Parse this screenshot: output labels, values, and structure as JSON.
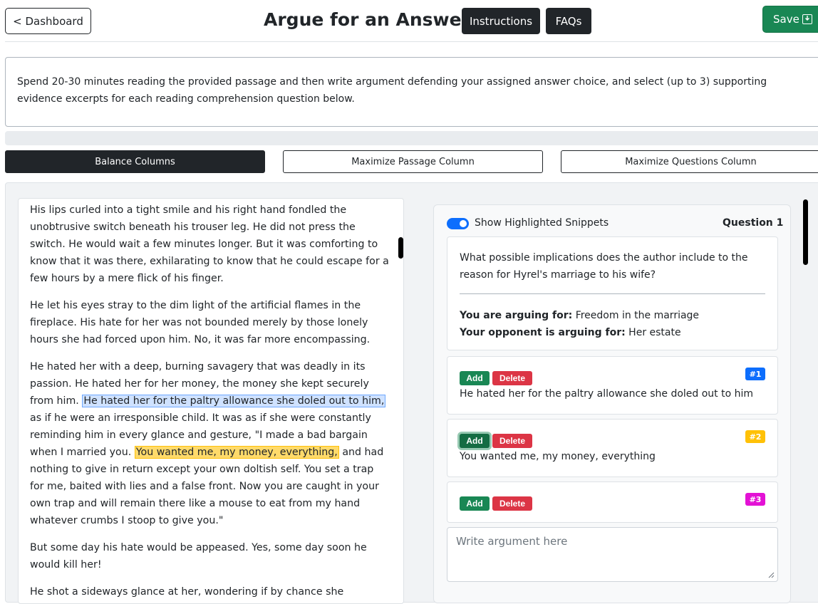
{
  "header": {
    "dashboard_label": "< Dashboard",
    "title": "Argue for an Answer",
    "instructions_label": "Instructions",
    "faqs_label": "FAQs",
    "save_label": "Save"
  },
  "instructions_text": "Spend 20-30 minutes reading the provided passage and then write argument defending your assigned answer choice, and select (up to 3) supporting evidence excerpts for each reading comprehension question below.",
  "layout_buttons": {
    "balance": "Balance Columns",
    "max_passage": "Maximize Passage Column",
    "max_questions": "Maximize Questions Column"
  },
  "passage": {
    "p1": "His lips curled into a tight smile and his right hand fondled the unobtrusive switch beneath his trouser leg. He did not press the switch. He would wait a few minutes longer. But it was comforting to know that it was there, exhilarating to know that he could escape for a few hours by a mere flick of his finger.",
    "p2": "He let his eyes stray to the dim light of the artificial flames in the fireplace. His hate for her was not bounded merely by those lonely hours she had forced upon him. No, it was far more encompassing.",
    "p3_a": "He hated her with a deep, burning savagery that was deadly in its passion. He hated her for her money, the money she kept securely from him. ",
    "p3_hl1": "He hated her for the paltry allowance she doled out to him,",
    "p3_b": " as if he were an irresponsible child. It was as if she were constantly reminding him in every glance and gesture, \"I made a bad bargain when I married you. ",
    "p3_hl2": "You wanted me, my money, everything,",
    "p3_c": " and had nothing to give in return except your own doltish self. You set a trap for me, baited with lies and a false front. Now you are caught in your own trap and will remain there like a mouse to eat from my hand whatever crumbs I stoop to give you.\"",
    "p4": "But some day his hate would be appeased. Yes, some day soon he would kill her!",
    "p5": "He shot a sideways glance at her, wondering if by chance she"
  },
  "question": {
    "toggle_label": "Show Highlighted Snippets",
    "number_label": "Question 1",
    "text": "What possible implications does the author include to the reason for Hyrel's marriage to his wife?",
    "arguing_for_label": "You are arguing for:",
    "arguing_for_value": "Freedom in the marriage",
    "opponent_label": "Your opponent is arguing for:",
    "opponent_value": "Her estate"
  },
  "snippets": [
    {
      "add": "Add",
      "delete": "Delete",
      "badge": "#1",
      "text": "He hated her for the paltry allowance she doled out to him"
    },
    {
      "add": "Add",
      "delete": "Delete",
      "badge": "#2",
      "text": "You wanted me, my money, everything"
    },
    {
      "add": "Add",
      "delete": "Delete",
      "badge": "#3",
      "text": ""
    }
  ],
  "argument_placeholder": "Write argument here",
  "colors": {
    "save_green": "#198754",
    "dark": "#212529",
    "highlight_blue": "#cfe2ff",
    "highlight_yellow": "#ffda6a",
    "badge_blue": "#0d6efd",
    "badge_yellow": "#ffc107",
    "badge_magenta": "#e312d5",
    "delete_red": "#dc3545"
  },
  "icons": {
    "save": "save-download-icon",
    "toggle": "toggle-switch-on"
  }
}
